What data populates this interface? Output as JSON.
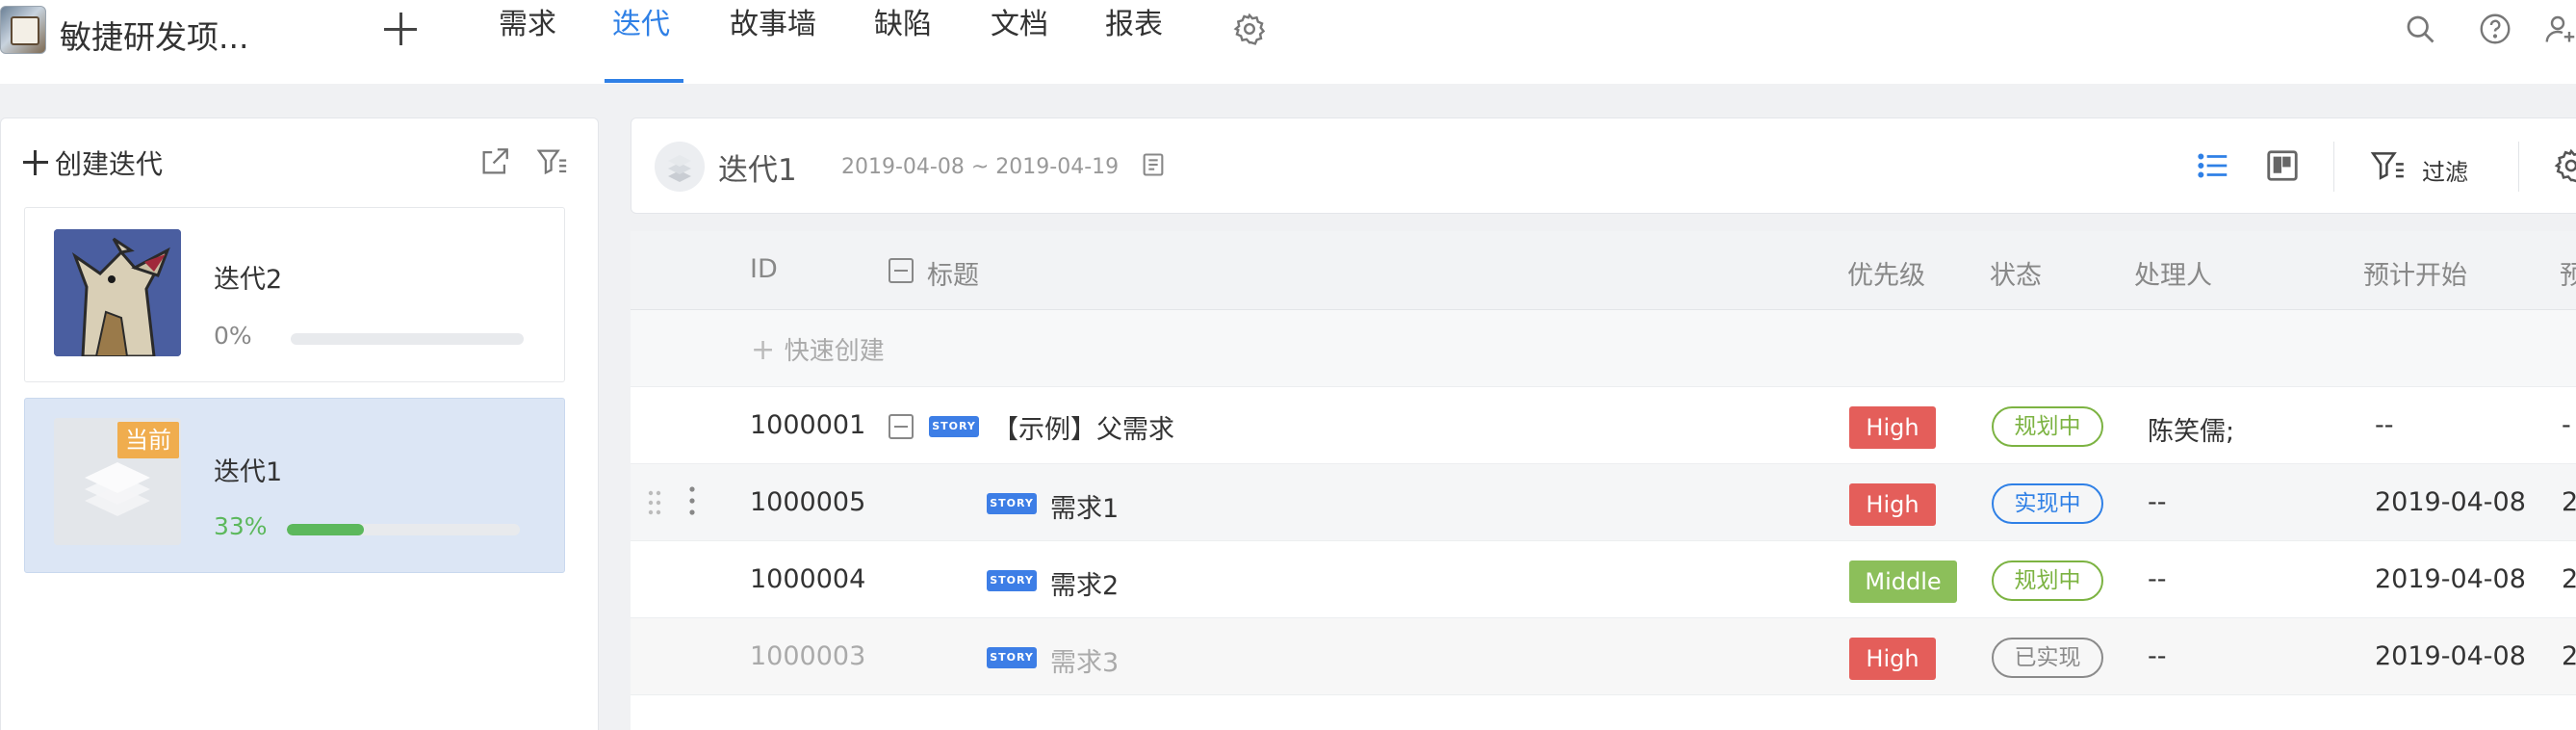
{
  "topnav": {
    "project_name": "敏捷研发项...",
    "tabs": [
      "需求",
      "迭代",
      "故事墙",
      "缺陷",
      "文档",
      "报表"
    ],
    "active_tab": "迭代"
  },
  "sidebar": {
    "create_label": "创建迭代",
    "iterations": [
      {
        "title": "迭代2",
        "progress_label": "0%",
        "progress": 0
      },
      {
        "title": "迭代1",
        "progress_label": "33%",
        "progress": 0.33,
        "badge": "当前"
      }
    ]
  },
  "sprint": {
    "title": "迭代1",
    "dates": "2019-04-08 ~ 2019-04-19",
    "filter_label": "过滤"
  },
  "table": {
    "headers": {
      "id": "ID",
      "title": "标题",
      "priority": "优先级",
      "status": "状态",
      "assignee": "处理人",
      "start": "预计开始",
      "cut": "预"
    },
    "quick_create": "快速创建",
    "story_tag": "STORY",
    "rows": [
      {
        "id": "1000001",
        "title": "【示例】父需求",
        "priority": "High",
        "status": "规划中",
        "assignee": "陈笑儒;",
        "start": "--",
        "extra": "-"
      },
      {
        "id": "1000005",
        "title": "需求1",
        "priority": "High",
        "status": "实现中",
        "assignee": "--",
        "start": "2019-04-08",
        "extra": "2"
      },
      {
        "id": "1000004",
        "title": "需求2",
        "priority": "Middle",
        "status": "规划中",
        "assignee": "--",
        "start": "2019-04-08",
        "extra": "2"
      },
      {
        "id": "1000003",
        "title": "需求3",
        "priority": "High",
        "status": "已实现",
        "assignee": "--",
        "start": "2019-04-08",
        "extra": "2"
      }
    ]
  },
  "colors": {
    "accent": "#2f80e6",
    "high": "#e45e5a",
    "middle": "#8cbf5a",
    "planning": "#7cb342",
    "implementing": "#2f80e6",
    "done": "#8a8a8a",
    "progress_green": "#5cb85c",
    "badge_orange": "#f0ad4e"
  }
}
